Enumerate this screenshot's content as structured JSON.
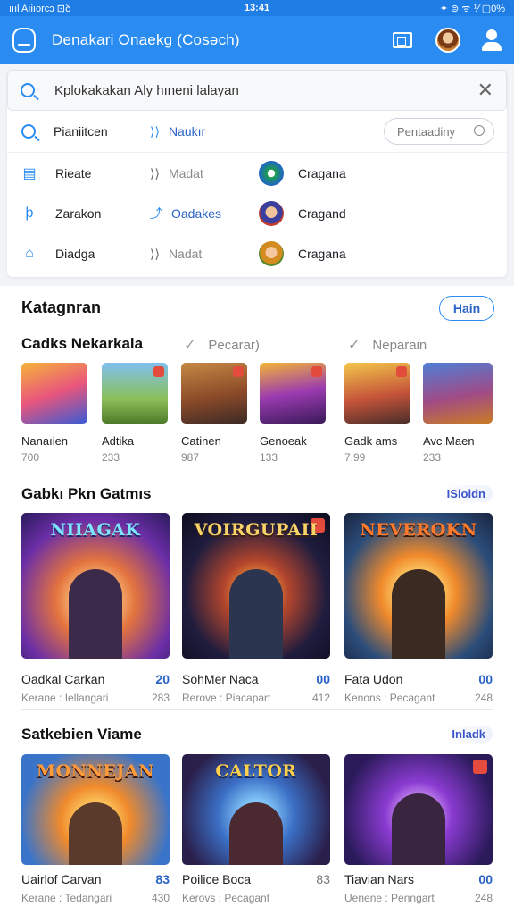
{
  "status": {
    "left": "ıııl Aıiıorcɔ ⊡ꝺ",
    "time": "13:41",
    "right": "✦ ⊜ ᯤ ⅟ ▢0%"
  },
  "appbar": {
    "title": "Denakari Onaekg (Cosəch)"
  },
  "search": {
    "query": "Kplokakakan Aly hıneni lalayan"
  },
  "rows": [
    {
      "label": "Pianiitcen",
      "mid": "Naukır",
      "pill": "Pentaadiny"
    },
    {
      "label": "Rieate",
      "mid": "Madat",
      "right": "Cragana"
    },
    {
      "label": "Zarakon",
      "mid": "Oadakes",
      "right": "Cragand"
    },
    {
      "label": "Diadga",
      "mid": "Nadat",
      "right": "Cragana"
    }
  ],
  "categories": {
    "heading": "Katagnran",
    "button": "Hain"
  },
  "section1": {
    "heading": "Cadks Nekarkala",
    "filters": [
      "Pecarar)",
      "Neparain"
    ],
    "items": [
      {
        "name": "Nanaıien",
        "value": "700"
      },
      {
        "name": "Adtika",
        "value": "233"
      },
      {
        "name": "Catinen",
        "value": "987"
      },
      {
        "name": "Genoeak",
        "value": "133"
      },
      {
        "name": "Gadk ams",
        "value": "7.99"
      },
      {
        "name": "Avc Maen",
        "value": "233"
      }
    ]
  },
  "section2": {
    "heading": "Gabkı Pkn Gatmıs",
    "more": "ISioidn",
    "cards": [
      {
        "art": "NIIAGAK",
        "name": "Oadkal Carkan",
        "score": "20",
        "sub": "Kerane : Iellangari",
        "count": "283"
      },
      {
        "art": "VOIRGUPAII",
        "name": "SohMer Naca",
        "score": "00",
        "sub": "Rerove : Piacapart",
        "count": "412"
      },
      {
        "art": "NEVEROKN",
        "name": "Fata Udon",
        "score": "00",
        "sub": "Kenons : Pecagant",
        "count": "248"
      }
    ]
  },
  "section3": {
    "heading": "Satkebien Viame",
    "more": "Inladk",
    "cards": [
      {
        "art": "MONNEJAN",
        "name": "Uairlof Carvan",
        "score": "83",
        "sub": "Kerane : Tedangari",
        "count": "430"
      },
      {
        "art": "CALTOR",
        "name": "Poilice Boca",
        "score": "83",
        "sub": "Kerovs : Pecagant",
        "count": ""
      },
      {
        "art": "",
        "name": "Tiavian Nars",
        "score": "00",
        "sub": "Uenene : Penngart",
        "count": "248"
      }
    ]
  }
}
